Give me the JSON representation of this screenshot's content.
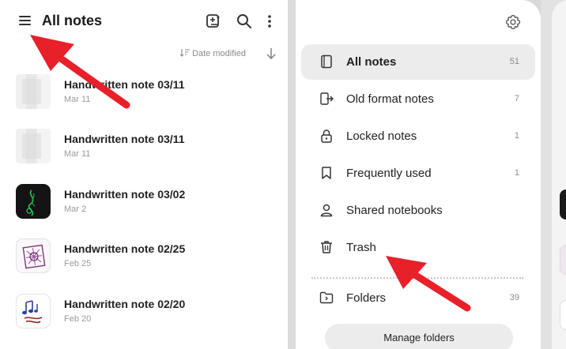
{
  "header": {
    "title": "All notes",
    "icons": [
      "menu-icon",
      "new-note-icon",
      "search-icon",
      "more-options-icon"
    ]
  },
  "sort": {
    "label": "Date modified",
    "icon": "sort-icon",
    "direction_icon": "arrow-down-icon"
  },
  "notes": [
    {
      "title": "Handwritten note 03/11",
      "date": "Mar 11",
      "thumb": "blurred"
    },
    {
      "title": "Handwritten note 03/11",
      "date": "Mar 11",
      "thumb": "blurred"
    },
    {
      "title": "Handwritten note 03/02",
      "date": "Mar 2",
      "thumb": "dark-green-drawing"
    },
    {
      "title": "Handwritten note 02/25",
      "date": "Feb 25",
      "thumb": "purple-pattern"
    },
    {
      "title": "Handwritten note 02/20",
      "date": "Feb 20",
      "thumb": "blue-music-notes"
    }
  ],
  "drawer": {
    "settings_icon": "gear-icon",
    "items": [
      {
        "label": "All notes",
        "count": "51",
        "icon": "notebook-icon",
        "active": true
      },
      {
        "label": "Old format notes",
        "count": "7",
        "icon": "import-icon",
        "active": false
      },
      {
        "label": "Locked notes",
        "count": "1",
        "icon": "lock-icon",
        "active": false
      },
      {
        "label": "Frequently used",
        "count": "1",
        "icon": "bookmark-icon",
        "active": false
      },
      {
        "label": "Shared notebooks",
        "count": "",
        "icon": "person-icon",
        "active": false
      },
      {
        "label": "Trash",
        "count": "",
        "icon": "trash-icon",
        "active": false
      },
      {
        "label": "Folders",
        "count": "39",
        "icon": "folder-icon",
        "active": false
      }
    ],
    "manage_label": "Manage folders"
  },
  "colors": {
    "annotation_arrow": "#e8202a",
    "active_item_bg": "#ececec",
    "panel_bg": "#ffffff",
    "divider": "#dcdcdc"
  }
}
